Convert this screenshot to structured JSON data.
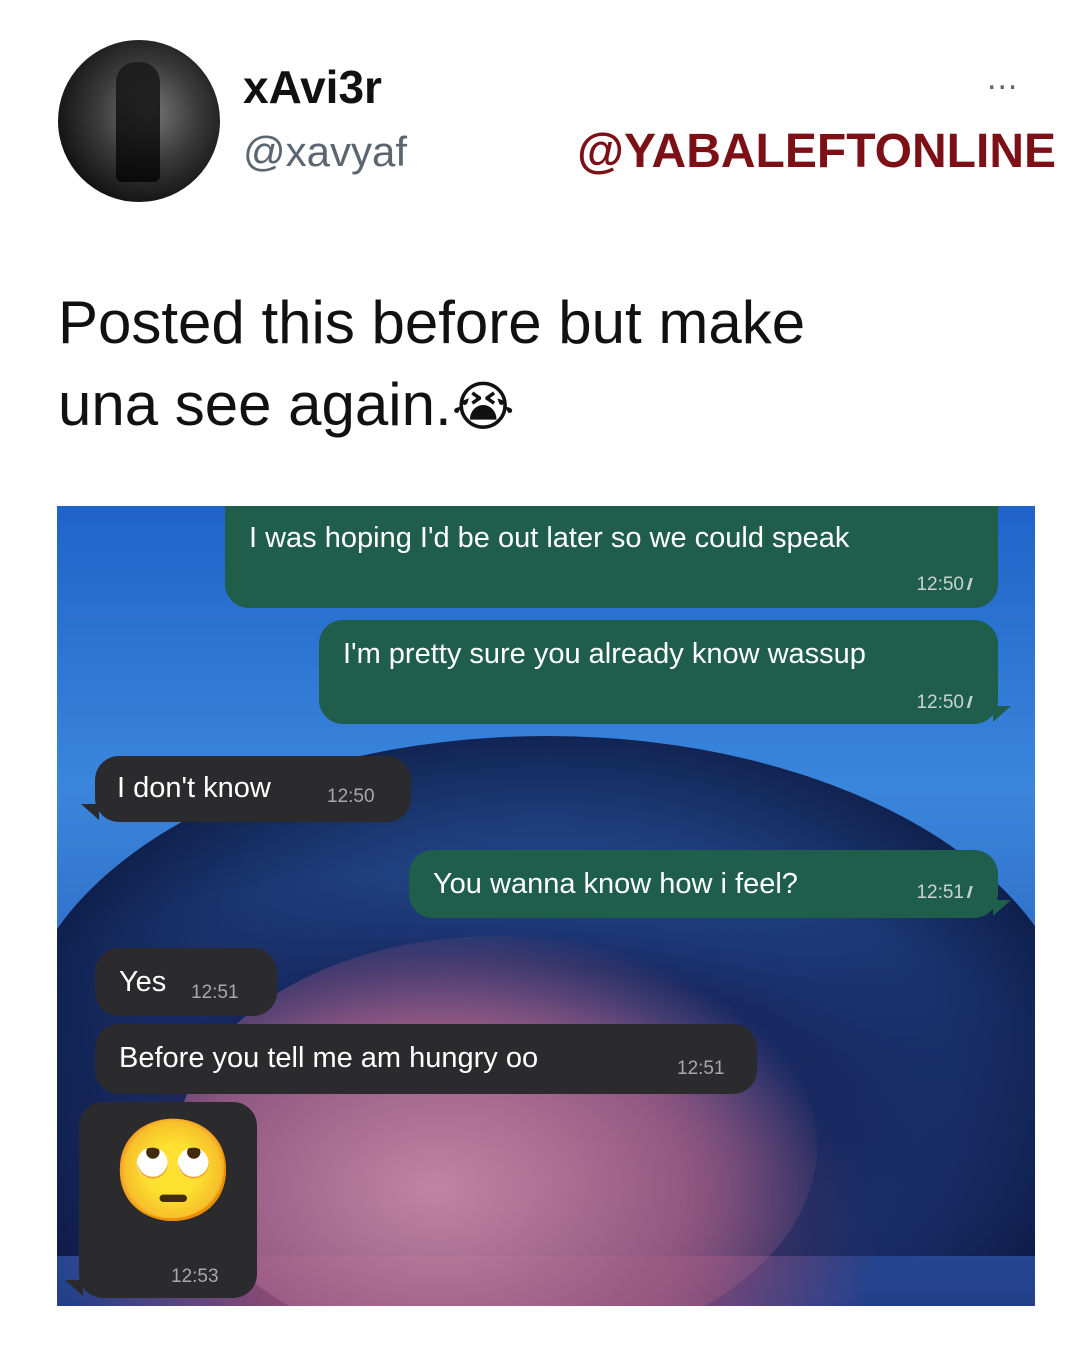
{
  "tweet": {
    "display_name": "xAvi3r",
    "handle": "@xavyaf",
    "more_label": "...",
    "text_line1": "Posted this before but make",
    "text_line2": "una see again.",
    "text_emoji": "😭"
  },
  "watermark": "@YABALEFTONLINE",
  "chat": {
    "messages": [
      {
        "direction": "outgoing",
        "text": "I was hoping I'd be out later so we could speak",
        "time": "12:50",
        "ticks": "//"
      },
      {
        "direction": "outgoing",
        "text": "I'm pretty sure you already know wassup",
        "time": "12:50",
        "ticks": "//"
      },
      {
        "direction": "incoming",
        "text": "I don't know",
        "time": "12:50"
      },
      {
        "direction": "outgoing",
        "text": "You wanna know how i feel?",
        "time": "12:51",
        "ticks": "//"
      },
      {
        "direction": "incoming",
        "text": "Yes",
        "time": "12:51"
      },
      {
        "direction": "incoming",
        "text": "Before you tell me am hungry oo",
        "time": "12:51"
      },
      {
        "direction": "incoming",
        "text": "🙄",
        "time": "12:53"
      }
    ]
  },
  "colors": {
    "outgoing_bubble": "#1f5e4a",
    "incoming_bubble": "#2b2b2d",
    "watermark": "#7c1016",
    "handle_gray": "#5b6670"
  }
}
